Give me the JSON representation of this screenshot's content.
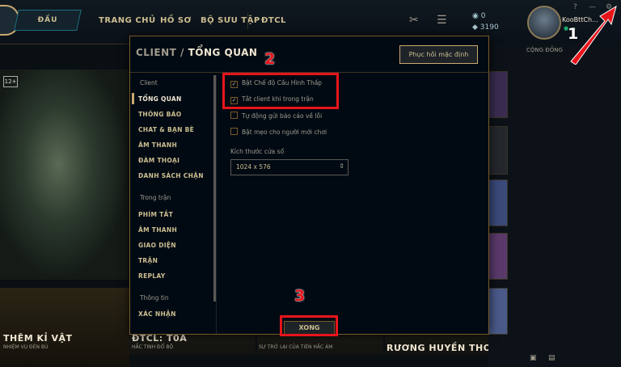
{
  "topbar": {
    "play_label": "ĐẤU",
    "nav": [
      "TRANG CHỦ",
      "HỒ SƠ",
      "BỘ SƯU TẬP",
      "ĐTCL"
    ],
    "rp_amount": "0",
    "be_amount": "3190",
    "username": "KooBttCh...",
    "win_help": "?",
    "win_minimize": "—",
    "win_settings_icon": "gear-icon"
  },
  "right_panel": {
    "tab_label": "CỘNG ĐỒNG"
  },
  "background": {
    "badge": "12+",
    "promos": [
      {
        "title": "THÊM KỈ VẬT",
        "subtitle": "NHIỆM VỤ ĐÊN BÙ"
      },
      {
        "title": "ĐTCL: T0À",
        "subtitle": "HẮC TINH ĐỔ BỘ"
      },
      {
        "title": "",
        "subtitle": "SỰ TRỞ LẠI CỦA TIÊN HẮC ÁM"
      },
      {
        "title": "RƯƠNG HUYỀN THOẠI",
        "subtitle": ""
      }
    ]
  },
  "modal": {
    "title_section": "CLIENT /",
    "title_page": "TỔNG QUAN",
    "reset_button": "Phục hồi mặc định",
    "sidebar": {
      "client_header": "Client",
      "client_items": [
        "TỔNG QUAN",
        "THÔNG BÁO",
        "CHAT & BẠN BÈ",
        "ÂM THANH",
        "ĐÀM THOẠI",
        "DANH SÁCH CHẶN"
      ],
      "ingame_header": "Trong trận",
      "ingame_items": [
        "PHÍM TẮT",
        "ÂM THANH",
        "GIAO DIỆN",
        "TRẬN",
        "REPLAY"
      ],
      "info_header": "Thông tin",
      "info_items": [
        "XÁC NHẬN"
      ]
    },
    "options": [
      {
        "label": "Bật Chế độ Cấu Hình Thấp",
        "checked": true
      },
      {
        "label": "Tắt client khi trong trận",
        "checked": true
      },
      {
        "label": "Tự động gửi báo cáo về lỗi",
        "checked": false
      },
      {
        "label": "Bật mẹo cho người mới chơi",
        "checked": false
      }
    ],
    "window_size_label": "Kích thước cửa sổ",
    "window_size_value": "1024 x 576",
    "done_button": "XONG"
  },
  "annotations": {
    "step1": "1",
    "step2": "2",
    "step3": "3",
    "color": "#e8141b"
  }
}
